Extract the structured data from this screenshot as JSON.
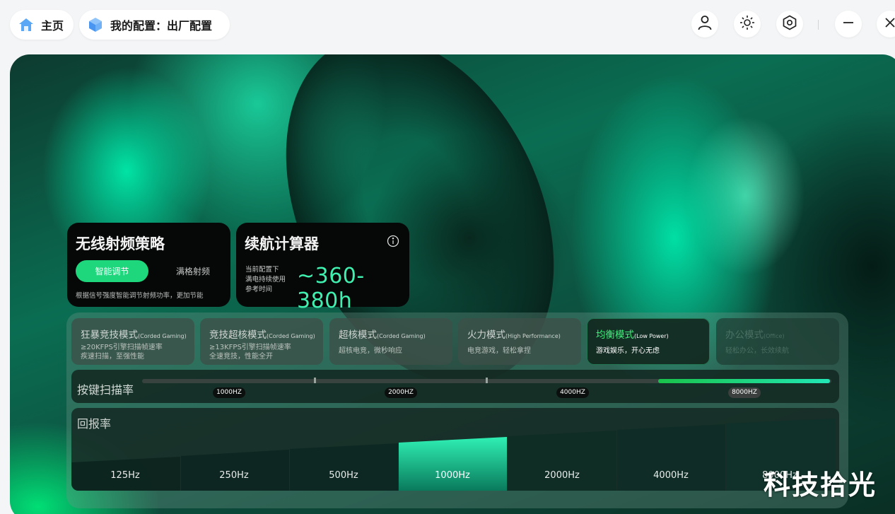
{
  "topbar": {
    "home_label": "主页",
    "config_label": "我的配置：出厂配置",
    "icons": [
      "home-icon",
      "cube-icon",
      "user-icon",
      "brightness-icon",
      "settings-icon",
      "minimize-icon",
      "close-icon"
    ]
  },
  "rf_card": {
    "title": "无线射频策略",
    "option_smart": "智能调节",
    "option_full": "满格射频",
    "description": "根据信号强度智能调节射频功率，更加节能"
  },
  "battery_card": {
    "title": "续航计算器",
    "line1": "当前配置下",
    "line2": "满电持续使用",
    "line3": "参考时间",
    "value": "~360-380h"
  },
  "modes": [
    {
      "title": "狂暴竞技模式",
      "sub": "(Corded Gaming)",
      "desc1": "≥20KFPS引擎扫描帧速率",
      "desc2": "疾速扫描，至强性能"
    },
    {
      "title": "竞技超核模式",
      "sub": "(Corded Gaming)",
      "desc1": "≥13KFPS引擎扫描帧速率",
      "desc2": "全速竞技，性能全开"
    },
    {
      "title": "超核模式",
      "sub": "(Corded Gaming)",
      "desc1": "超核电竞，微秒响应",
      "desc2": ""
    },
    {
      "title": "火力模式",
      "sub": "(High Performance)",
      "desc1": "电竞游戏，轻松拿捏",
      "desc2": ""
    },
    {
      "title": "均衡模式",
      "sub": "(Low Power)",
      "desc1": "游戏娱乐，开心无虑",
      "desc2": ""
    },
    {
      "title": "办公模式",
      "sub": "(Office)",
      "desc1": "轻松办公，长效续航",
      "desc2": ""
    }
  ],
  "active_mode_index": 4,
  "scan_rate": {
    "title": "按键扫描率",
    "options": [
      "1000HZ",
      "2000HZ",
      "4000HZ",
      "8000HZ"
    ],
    "selected": "8000HZ"
  },
  "report_rate": {
    "title": "回报率",
    "options": [
      "125Hz",
      "250Hz",
      "500Hz",
      "1000Hz",
      "2000Hz",
      "4000Hz",
      "8000Hz"
    ],
    "selected": "1000Hz"
  },
  "watermark": "科技拾光",
  "colors": {
    "accent_green": "#1ed67c",
    "battery_value": "#3ff0b0",
    "active_mode_title": "#3ff07a"
  }
}
